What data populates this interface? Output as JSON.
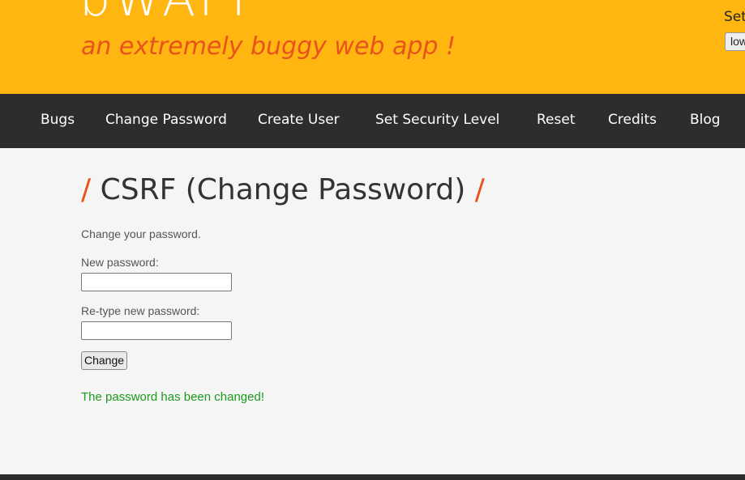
{
  "header": {
    "logo": "bWAPP",
    "tagline": "an extremely buggy web app !",
    "security_label": "Set",
    "security_value": "low"
  },
  "nav": {
    "items": [
      {
        "label": "Bugs"
      },
      {
        "label": "Change Password"
      },
      {
        "label": "Create User"
      },
      {
        "label": "Set Security Level"
      },
      {
        "label": "Reset"
      },
      {
        "label": "Credits"
      },
      {
        "label": "Blog"
      }
    ]
  },
  "main": {
    "title_slash_left": "/",
    "title": "CSRF (Change Password)",
    "title_slash_right": "/",
    "intro": "Change your password.",
    "new_password_label": "New password:",
    "new_password_value": "",
    "retype_password_label": "Re-type new password:",
    "retype_password_value": "",
    "change_button": "Change",
    "status_message": "The password has been changed!"
  },
  "colors": {
    "header_bg": "#ffb610",
    "accent": "#e8531c",
    "nav_bg": "#2d2d2d",
    "success": "#1c9a1c"
  }
}
